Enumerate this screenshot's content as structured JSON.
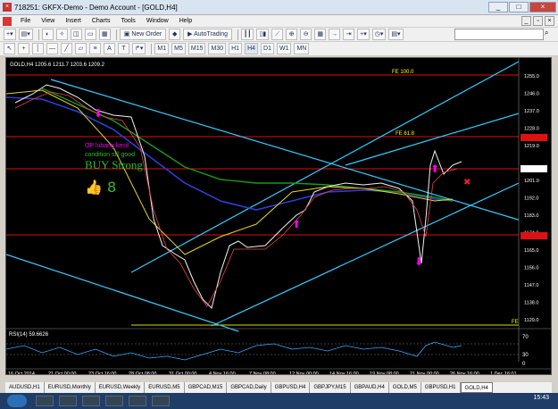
{
  "window": {
    "app_icon": "metatrader-icon",
    "title": "718251: GKFX-Demo - Demo Account - [GOLD,H4]"
  },
  "menu": [
    "File",
    "View",
    "Insert",
    "Charts",
    "Tools",
    "Window",
    "Help"
  ],
  "toolbar1": {
    "new_order": "New Order",
    "autotrading": "AutoTrading"
  },
  "timeframes": [
    "M1",
    "M5",
    "M15",
    "M30",
    "H1",
    "H4",
    "D1",
    "W1",
    "MN"
  ],
  "chart": {
    "symbol_line": "GOLD,H4  1205.6 1211.7 1203.6 1209.2",
    "fe_top": "FE 100.0",
    "fe_mid": "FE 61.8",
    "fe_bottom": "FE 61.8",
    "annotation_1": "OP lubang kecil",
    "annotation_2": "condition stil good",
    "annotation_3": "BUY Strong",
    "thumb_text": "👍 8",
    "price_labels": [
      "1255.0",
      "1246.0",
      "1237.0",
      "1228.0",
      "1219.0",
      "1210.5",
      "1201.0",
      "1192.0",
      "1183.0",
      "1174.0",
      "1165.0",
      "1156.0",
      "1147.0",
      "1138.0",
      "1129.0"
    ],
    "date_labels": [
      "16 Oct 2014",
      "21 Oct 00:00",
      "23 Oct 16:00",
      "28 Oct 08:00",
      "31 Oct 00:00",
      "4 Nov 16:00",
      "7 Nov 08:00",
      "12 Nov 00:00",
      "14 Nov 16:00",
      "19 Nov 08:00",
      "21 Nov 00:00",
      "26 Nov 16:00",
      "1 Dec 16:01"
    ],
    "rsi_label": "RSI(14) 59.6626",
    "rsi_levels": [
      "70",
      "30",
      "0"
    ]
  },
  "tabs": [
    "AUDUSD,H1",
    "EURUSD,Monthly",
    "EURUSD,Weekly",
    "EURUSD,M5",
    "GBPCAD,M15",
    "GBPCAD,Daily",
    "GBPUSD,H4",
    "GBPJPY,M15",
    "GBPAUD,H4",
    "GOLD,M5",
    "GBPUSD,H1",
    "GOLD,H4"
  ],
  "active_tab": "GOLD,H4",
  "taskbar": {
    "clock": "15:43"
  }
}
